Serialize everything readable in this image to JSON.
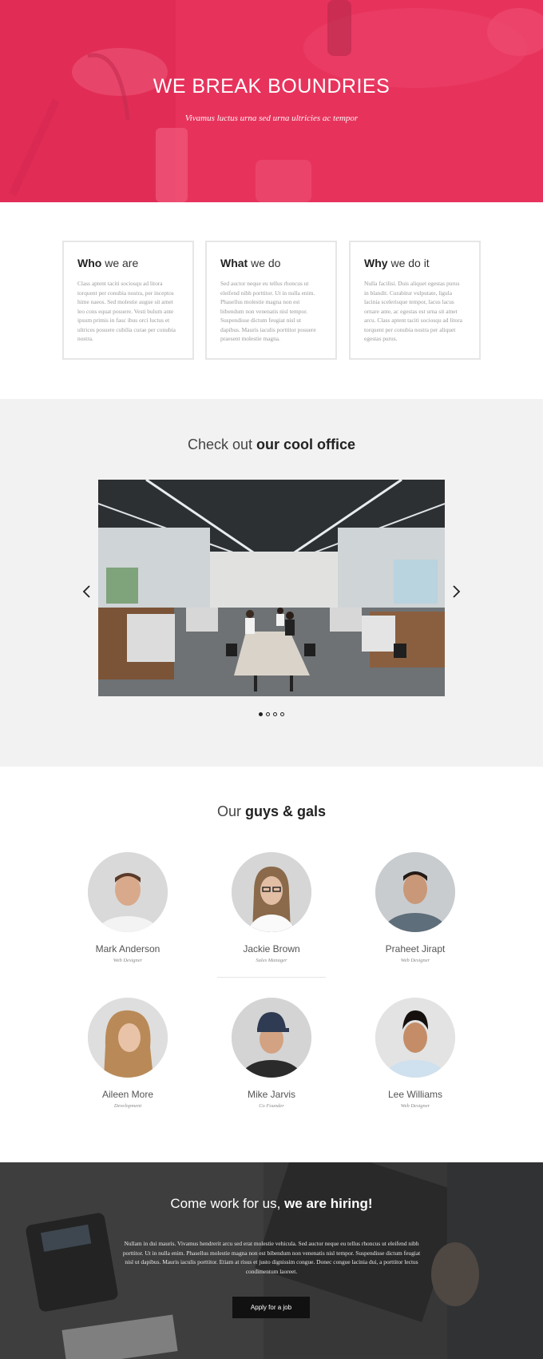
{
  "hero": {
    "title": "WE BREAK BOUNDRIES",
    "subtitle": "Vivamus luctus urna sed urna ultricies ac tempor",
    "overlay_color": "#f0285a"
  },
  "features": [
    {
      "title_bold": "Who",
      "title_rest": " we are",
      "text": "Class aptent taciti sociosqu ad litora torquent per conubia nostra, per inceptos hime naeos. Sed molestie augue sit amet leo cons equat posuere. Vesti bulum ante ipsum primis in fauc ibus orci luctus et ultrices posuere cubilia curae per conubia nostra."
    },
    {
      "title_bold": "What",
      "title_rest": " we do",
      "text": "Sed auctor neque eu tellus rhoncus ut eleifend nibh porttitor. Ut in nulla enim. Phasellus molestie magna non est bibendum non venenatis nisl tempor. Suspendisse dictum feugiat nisl ut dapibus. Mauris iaculis porttitor posuere praesent molestie magna."
    },
    {
      "title_bold": "Why",
      "title_rest": " we do it",
      "text": "Nulla facilisi. Duis aliquet egestas purus in blandit. Curabitur vulputate, ligula lacinia scelerisque tempor, lacus lacus ornare ante, ac egestas est urna sit amet arcu. Class aptent taciti sociosqu ad litora torquent per conubia nostra per aliquet egestas purus."
    }
  ],
  "office": {
    "title_light": "Check out ",
    "title_bold": "our cool office",
    "slide_count": 4,
    "active_slide": 1,
    "prev_icon": "chevron-left-icon",
    "next_icon": "chevron-right-icon"
  },
  "team": {
    "title_light": "Our ",
    "title_bold": "guys & gals",
    "members": [
      {
        "name": "Mark Anderson",
        "role": "Web Designer"
      },
      {
        "name": "Jackie Brown",
        "role": "Sales Manager"
      },
      {
        "name": "Praheet Jirapt",
        "role": "Web Designer"
      },
      {
        "name": "Aileen More",
        "role": "Development"
      },
      {
        "name": "Mike Jarvis",
        "role": "Co Founder"
      },
      {
        "name": "Lee Williams",
        "role": "Web Designer"
      }
    ]
  },
  "hiring": {
    "title_light": "Come work for us, ",
    "title_bold": "we are hiring!",
    "text": "Nullam in dui mauris. Vivamus hendrerit arcu sed erat molestie vehicula. Sed auctor neque eu tellus rhoncus ut eleifend nibh porttitor. Ut in nulla enim. Phasellus molestie magna non est bibendum non venenatis nisl tempor. Suspendisse dictum feugiat nisl ut dapibus. Mauris iaculis porttitor. Etiam at risus et justo dignissim congue. Donec congue lacinia dui, a porttitor lectus condimentum laoreet.",
    "button_label": "Apply for a job"
  }
}
